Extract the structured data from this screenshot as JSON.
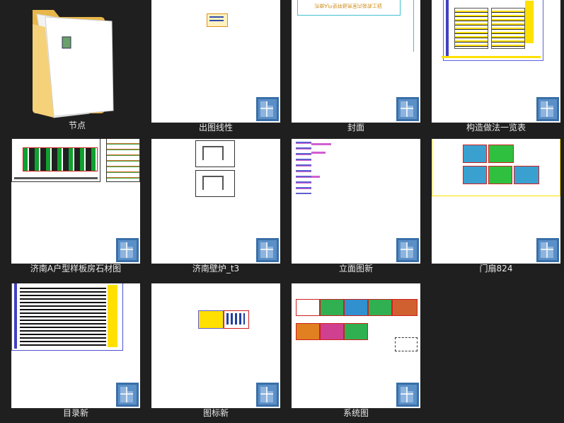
{
  "items": [
    {
      "name": "节点",
      "type": "folder"
    },
    {
      "name": "出图线性",
      "type": "dwg"
    },
    {
      "name": "封面",
      "type": "dwg"
    },
    {
      "name": "构造做法一览表",
      "type": "dwg"
    },
    {
      "name": "济南A户型样板房石材图",
      "type": "dwg"
    },
    {
      "name": "济南壁炉_t3",
      "type": "dwg"
    },
    {
      "name": "立面图新",
      "type": "dwg"
    },
    {
      "name": "门扇824",
      "type": "dwg"
    },
    {
      "name": "目录新",
      "type": "dwg"
    },
    {
      "name": "图标新",
      "type": "dwg"
    },
    {
      "name": "系统图",
      "type": "dwg"
    }
  ],
  "cover_text": "济南A户型样板房室内装饰工程"
}
